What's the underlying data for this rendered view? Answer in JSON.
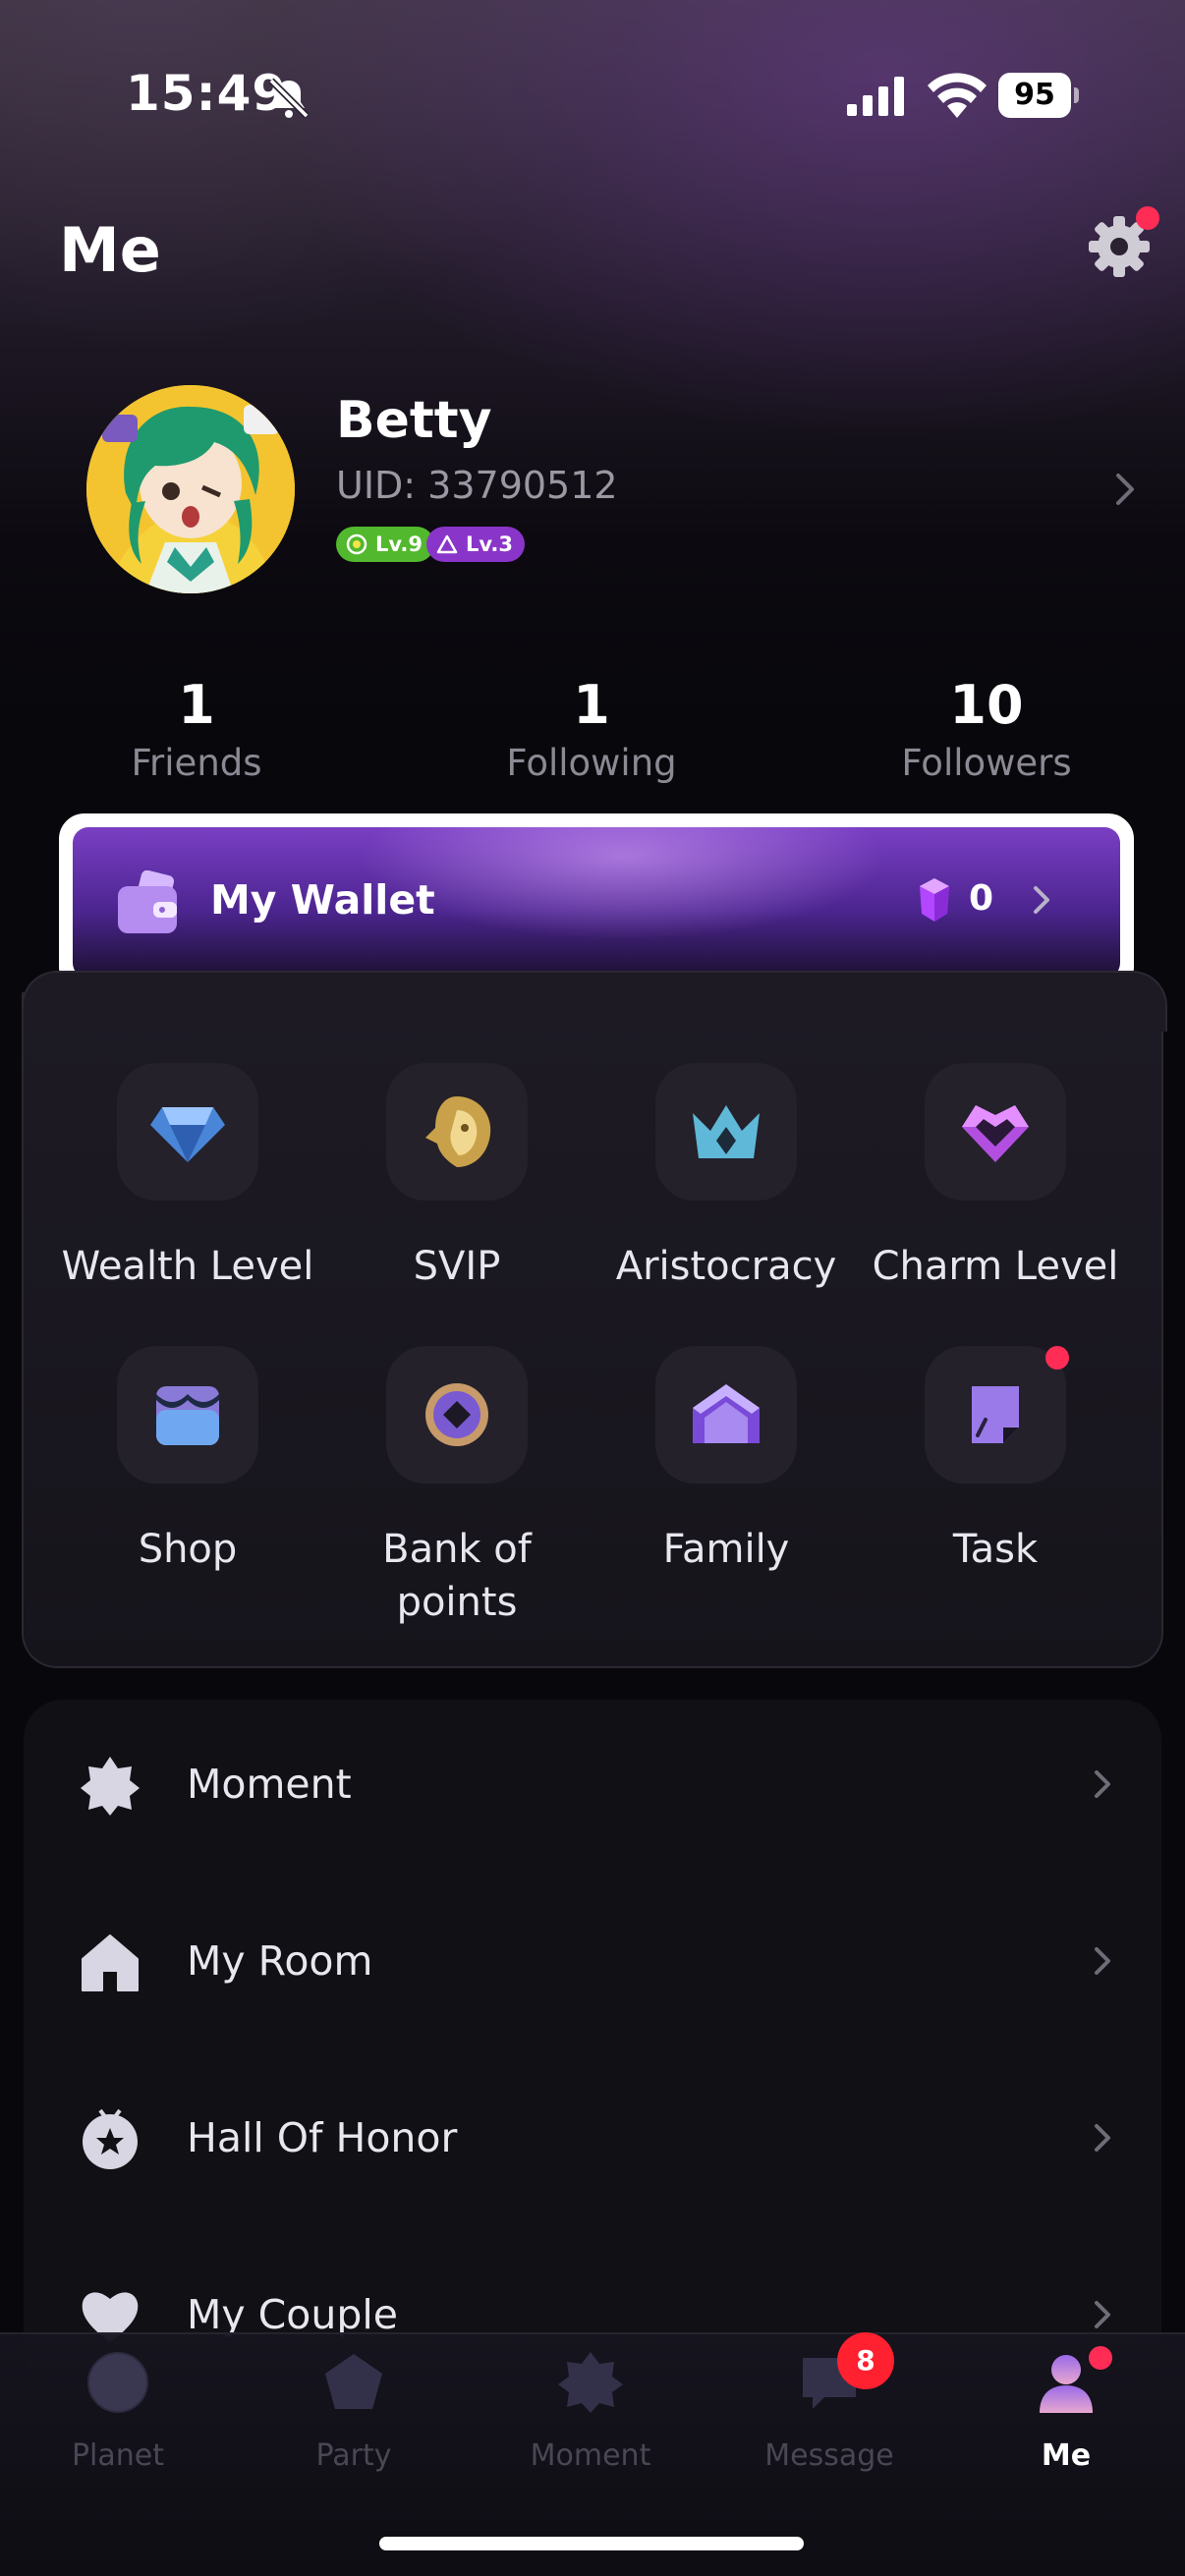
{
  "status_bar": {
    "time": "15:49",
    "battery": "95"
  },
  "header": {
    "title": "Me"
  },
  "profile": {
    "name": "Betty",
    "uid": "UID: 33790512",
    "wealth_badge": "Lv.9",
    "charm_badge": "Lv.3"
  },
  "stats": [
    {
      "value": "1",
      "label": "Friends"
    },
    {
      "value": "1",
      "label": "Following"
    },
    {
      "value": "10",
      "label": "Followers"
    }
  ],
  "wallet": {
    "label": "My Wallet",
    "amount": "0"
  },
  "features": [
    {
      "label": "Wealth Level",
      "icon": "diamond-icon"
    },
    {
      "label": "SVIP",
      "icon": "lion-icon"
    },
    {
      "label": "Aristocracy",
      "icon": "crown-icon"
    },
    {
      "label": "Charm Level",
      "icon": "heart-gem-icon"
    },
    {
      "label": "Shop",
      "icon": "shop-icon"
    },
    {
      "label": "Bank of points",
      "icon": "coin-icon"
    },
    {
      "label": "Family",
      "icon": "family-house-icon"
    },
    {
      "label": "Task",
      "icon": "task-note-icon"
    }
  ],
  "menu": [
    {
      "label": "Moment",
      "icon": "star-badge-icon"
    },
    {
      "label": "My Room",
      "icon": "home-icon"
    },
    {
      "label": "Hall Of Honor",
      "icon": "medal-icon"
    },
    {
      "label": "My Couple",
      "icon": "heart-icon"
    }
  ],
  "tabs": [
    {
      "label": "Planet",
      "icon": "planet-icon"
    },
    {
      "label": "Party",
      "icon": "pentagon-icon"
    },
    {
      "label": "Moment",
      "icon": "star-badge-icon"
    },
    {
      "label": "Message",
      "icon": "chat-icon",
      "badge": "8"
    },
    {
      "label": "Me",
      "icon": "person-icon",
      "active": true
    }
  ],
  "colors": {
    "accent": "#7a3fc4",
    "notification": "#ff2d55",
    "wealth": "#52b82d",
    "charm": "#8a35c9"
  }
}
